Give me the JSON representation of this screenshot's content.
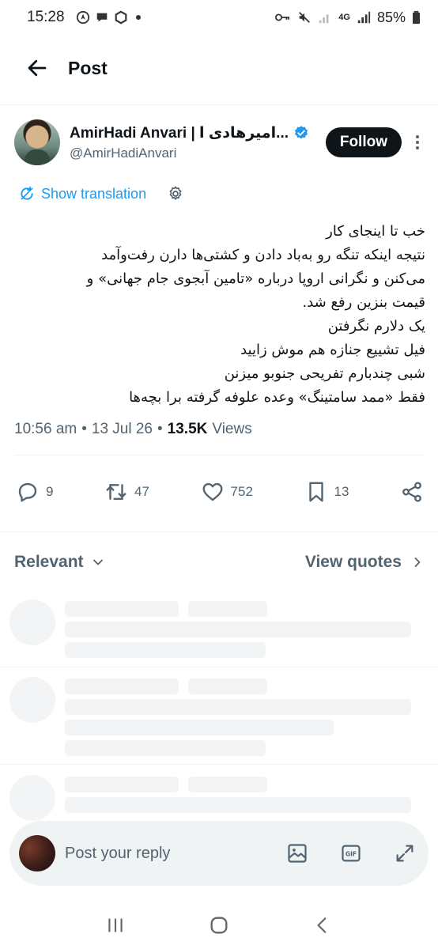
{
  "status_bar": {
    "time": "15:28",
    "battery": "85%",
    "network": "4G"
  },
  "header": {
    "title": "Post",
    "back_icon": "arrow-left-icon"
  },
  "author": {
    "display_name": "AmirHadi Anvari | امیرهادی ا...",
    "handle": "@AmirHadiAnvari",
    "verified": true,
    "follow_label": "Follow"
  },
  "translate": {
    "label": "Show translation"
  },
  "tweet": {
    "lines": [
      "خب تا اینجای کار",
      "نتیجه اینکه تنگه رو به‌باد دادن و کشتی‌ها دارن رفت‌وآمد",
      "می‌کنن و نگرانی اروپا درباره «تامین آبجوی جام جهانی» و",
      "قیمت بنزین رفع شد.",
      "یک دلارم نگرفتن",
      "فیل تشییع جنازه هم موش زایید",
      "شبی چندبارم تفریحی جنوبو میزنن",
      "فقط «ممد سامتینگ» وعده علوفه گرفته برا بچه‌ها"
    ]
  },
  "meta": {
    "time": "10:56 am",
    "date": "13 Jul 26",
    "views_count": "13.5K",
    "views_label": "Views",
    "separator": "•"
  },
  "actions": {
    "replies": "9",
    "reposts": "47",
    "likes": "752",
    "bookmarks": "13"
  },
  "replies_section": {
    "sort_label": "Relevant",
    "quotes_label": "View quotes"
  },
  "composer": {
    "placeholder": "Post your reply"
  },
  "colors": {
    "accent": "#1d9bf0",
    "text": "#0f1419",
    "muted": "#536471",
    "follow_bg": "#0f1419"
  }
}
